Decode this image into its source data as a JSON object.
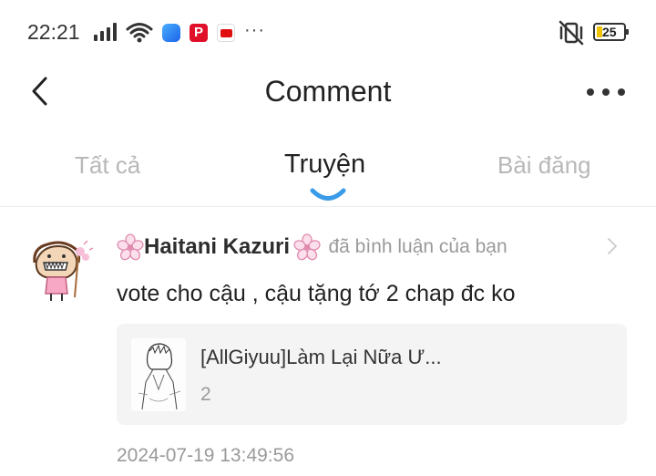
{
  "status_bar": {
    "time": "22:21",
    "more_indicator": "···",
    "battery_level": "25",
    "icons": [
      "signal-icon",
      "wifi-icon",
      "messenger-icon",
      "pinterest-icon",
      "youtube-icon",
      "vibrate-mute-icon",
      "battery-icon"
    ]
  },
  "header": {
    "title": "Comment",
    "back_icon": "chevron-left-icon",
    "more_icon": "more-dots-icon"
  },
  "tabs": [
    {
      "label": "Tất cả",
      "active": false
    },
    {
      "label": "Truyện",
      "active": true
    },
    {
      "label": "Bài đăng",
      "active": false
    }
  ],
  "comment": {
    "username": "Haitani Kazuri",
    "action": "đã bình luận của bạn",
    "text": "vote cho cậu , cậu tặng tớ 2 chap đc ko",
    "timestamp": "2024-07-19 13:49:56",
    "story": {
      "title": "[AllGiyuu]Làm Lại Nữa Ư...",
      "number": "2"
    }
  },
  "colors": {
    "accent": "#3a9be8",
    "muted_text": "#9a9a9a",
    "card_bg": "#f4f4f4"
  }
}
